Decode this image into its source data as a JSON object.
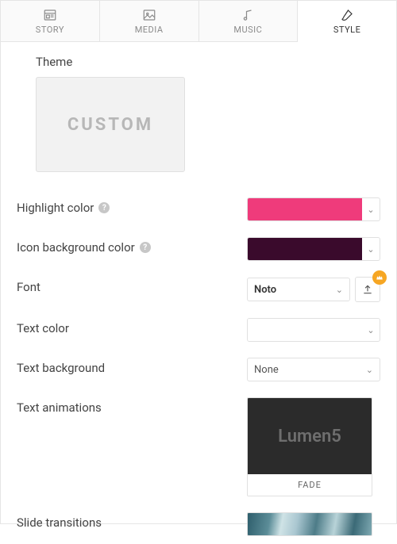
{
  "tabs": {
    "story": "STORY",
    "media": "MEDIA",
    "music": "MUSIC",
    "style": "STYLE"
  },
  "theme": {
    "heading": "Theme",
    "selected_label": "CUSTOM"
  },
  "highlight_color": {
    "label": "Highlight color",
    "value_hex": "#ef3b7b"
  },
  "icon_bg_color": {
    "label": "Icon background color",
    "value_hex": "#3a0a2c"
  },
  "font": {
    "label": "Font",
    "selected": "Noto"
  },
  "text_color": {
    "label": "Text color",
    "value_hex": "#ffffff"
  },
  "text_background": {
    "label": "Text background",
    "selected": "None"
  },
  "text_animations": {
    "label": "Text animations",
    "preview_text": "Lumen5",
    "caption": "FADE"
  },
  "slide_transitions": {
    "label": "Slide transitions"
  }
}
